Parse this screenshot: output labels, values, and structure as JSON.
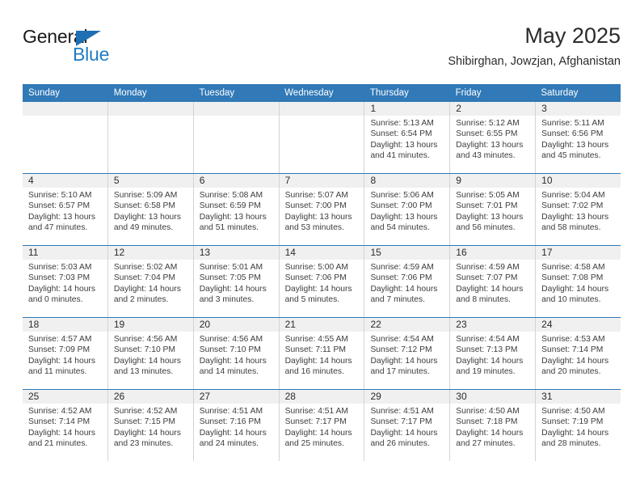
{
  "logo": {
    "word1": "General",
    "word2": "Blue",
    "triangle_color": "#1f6fb5",
    "word2_color": "#1f7ac4"
  },
  "header": {
    "title": "May 2025",
    "subtitle": "Shibirghan, Jowzjan, Afghanistan",
    "accent_color": "#3179b7"
  },
  "weekdays": [
    "Sunday",
    "Monday",
    "Tuesday",
    "Wednesday",
    "Thursday",
    "Friday",
    "Saturday"
  ],
  "weeks": [
    [
      {
        "day": "",
        "sunrise": "",
        "sunset": "",
        "daylight1": "",
        "daylight2": ""
      },
      {
        "day": "",
        "sunrise": "",
        "sunset": "",
        "daylight1": "",
        "daylight2": ""
      },
      {
        "day": "",
        "sunrise": "",
        "sunset": "",
        "daylight1": "",
        "daylight2": ""
      },
      {
        "day": "",
        "sunrise": "",
        "sunset": "",
        "daylight1": "",
        "daylight2": ""
      },
      {
        "day": "1",
        "sunrise": "Sunrise: 5:13 AM",
        "sunset": "Sunset: 6:54 PM",
        "daylight1": "Daylight: 13 hours",
        "daylight2": "and 41 minutes."
      },
      {
        "day": "2",
        "sunrise": "Sunrise: 5:12 AM",
        "sunset": "Sunset: 6:55 PM",
        "daylight1": "Daylight: 13 hours",
        "daylight2": "and 43 minutes."
      },
      {
        "day": "3",
        "sunrise": "Sunrise: 5:11 AM",
        "sunset": "Sunset: 6:56 PM",
        "daylight1": "Daylight: 13 hours",
        "daylight2": "and 45 minutes."
      }
    ],
    [
      {
        "day": "4",
        "sunrise": "Sunrise: 5:10 AM",
        "sunset": "Sunset: 6:57 PM",
        "daylight1": "Daylight: 13 hours",
        "daylight2": "and 47 minutes."
      },
      {
        "day": "5",
        "sunrise": "Sunrise: 5:09 AM",
        "sunset": "Sunset: 6:58 PM",
        "daylight1": "Daylight: 13 hours",
        "daylight2": "and 49 minutes."
      },
      {
        "day": "6",
        "sunrise": "Sunrise: 5:08 AM",
        "sunset": "Sunset: 6:59 PM",
        "daylight1": "Daylight: 13 hours",
        "daylight2": "and 51 minutes."
      },
      {
        "day": "7",
        "sunrise": "Sunrise: 5:07 AM",
        "sunset": "Sunset: 7:00 PM",
        "daylight1": "Daylight: 13 hours",
        "daylight2": "and 53 minutes."
      },
      {
        "day": "8",
        "sunrise": "Sunrise: 5:06 AM",
        "sunset": "Sunset: 7:00 PM",
        "daylight1": "Daylight: 13 hours",
        "daylight2": "and 54 minutes."
      },
      {
        "day": "9",
        "sunrise": "Sunrise: 5:05 AM",
        "sunset": "Sunset: 7:01 PM",
        "daylight1": "Daylight: 13 hours",
        "daylight2": "and 56 minutes."
      },
      {
        "day": "10",
        "sunrise": "Sunrise: 5:04 AM",
        "sunset": "Sunset: 7:02 PM",
        "daylight1": "Daylight: 13 hours",
        "daylight2": "and 58 minutes."
      }
    ],
    [
      {
        "day": "11",
        "sunrise": "Sunrise: 5:03 AM",
        "sunset": "Sunset: 7:03 PM",
        "daylight1": "Daylight: 14 hours",
        "daylight2": "and 0 minutes."
      },
      {
        "day": "12",
        "sunrise": "Sunrise: 5:02 AM",
        "sunset": "Sunset: 7:04 PM",
        "daylight1": "Daylight: 14 hours",
        "daylight2": "and 2 minutes."
      },
      {
        "day": "13",
        "sunrise": "Sunrise: 5:01 AM",
        "sunset": "Sunset: 7:05 PM",
        "daylight1": "Daylight: 14 hours",
        "daylight2": "and 3 minutes."
      },
      {
        "day": "14",
        "sunrise": "Sunrise: 5:00 AM",
        "sunset": "Sunset: 7:06 PM",
        "daylight1": "Daylight: 14 hours",
        "daylight2": "and 5 minutes."
      },
      {
        "day": "15",
        "sunrise": "Sunrise: 4:59 AM",
        "sunset": "Sunset: 7:06 PM",
        "daylight1": "Daylight: 14 hours",
        "daylight2": "and 7 minutes."
      },
      {
        "day": "16",
        "sunrise": "Sunrise: 4:59 AM",
        "sunset": "Sunset: 7:07 PM",
        "daylight1": "Daylight: 14 hours",
        "daylight2": "and 8 minutes."
      },
      {
        "day": "17",
        "sunrise": "Sunrise: 4:58 AM",
        "sunset": "Sunset: 7:08 PM",
        "daylight1": "Daylight: 14 hours",
        "daylight2": "and 10 minutes."
      }
    ],
    [
      {
        "day": "18",
        "sunrise": "Sunrise: 4:57 AM",
        "sunset": "Sunset: 7:09 PM",
        "daylight1": "Daylight: 14 hours",
        "daylight2": "and 11 minutes."
      },
      {
        "day": "19",
        "sunrise": "Sunrise: 4:56 AM",
        "sunset": "Sunset: 7:10 PM",
        "daylight1": "Daylight: 14 hours",
        "daylight2": "and 13 minutes."
      },
      {
        "day": "20",
        "sunrise": "Sunrise: 4:56 AM",
        "sunset": "Sunset: 7:10 PM",
        "daylight1": "Daylight: 14 hours",
        "daylight2": "and 14 minutes."
      },
      {
        "day": "21",
        "sunrise": "Sunrise: 4:55 AM",
        "sunset": "Sunset: 7:11 PM",
        "daylight1": "Daylight: 14 hours",
        "daylight2": "and 16 minutes."
      },
      {
        "day": "22",
        "sunrise": "Sunrise: 4:54 AM",
        "sunset": "Sunset: 7:12 PM",
        "daylight1": "Daylight: 14 hours",
        "daylight2": "and 17 minutes."
      },
      {
        "day": "23",
        "sunrise": "Sunrise: 4:54 AM",
        "sunset": "Sunset: 7:13 PM",
        "daylight1": "Daylight: 14 hours",
        "daylight2": "and 19 minutes."
      },
      {
        "day": "24",
        "sunrise": "Sunrise: 4:53 AM",
        "sunset": "Sunset: 7:14 PM",
        "daylight1": "Daylight: 14 hours",
        "daylight2": "and 20 minutes."
      }
    ],
    [
      {
        "day": "25",
        "sunrise": "Sunrise: 4:52 AM",
        "sunset": "Sunset: 7:14 PM",
        "daylight1": "Daylight: 14 hours",
        "daylight2": "and 21 minutes."
      },
      {
        "day": "26",
        "sunrise": "Sunrise: 4:52 AM",
        "sunset": "Sunset: 7:15 PM",
        "daylight1": "Daylight: 14 hours",
        "daylight2": "and 23 minutes."
      },
      {
        "day": "27",
        "sunrise": "Sunrise: 4:51 AM",
        "sunset": "Sunset: 7:16 PM",
        "daylight1": "Daylight: 14 hours",
        "daylight2": "and 24 minutes."
      },
      {
        "day": "28",
        "sunrise": "Sunrise: 4:51 AM",
        "sunset": "Sunset: 7:17 PM",
        "daylight1": "Daylight: 14 hours",
        "daylight2": "and 25 minutes."
      },
      {
        "day": "29",
        "sunrise": "Sunrise: 4:51 AM",
        "sunset": "Sunset: 7:17 PM",
        "daylight1": "Daylight: 14 hours",
        "daylight2": "and 26 minutes."
      },
      {
        "day": "30",
        "sunrise": "Sunrise: 4:50 AM",
        "sunset": "Sunset: 7:18 PM",
        "daylight1": "Daylight: 14 hours",
        "daylight2": "and 27 minutes."
      },
      {
        "day": "31",
        "sunrise": "Sunrise: 4:50 AM",
        "sunset": "Sunset: 7:19 PM",
        "daylight1": "Daylight: 14 hours",
        "daylight2": "and 28 minutes."
      }
    ]
  ]
}
